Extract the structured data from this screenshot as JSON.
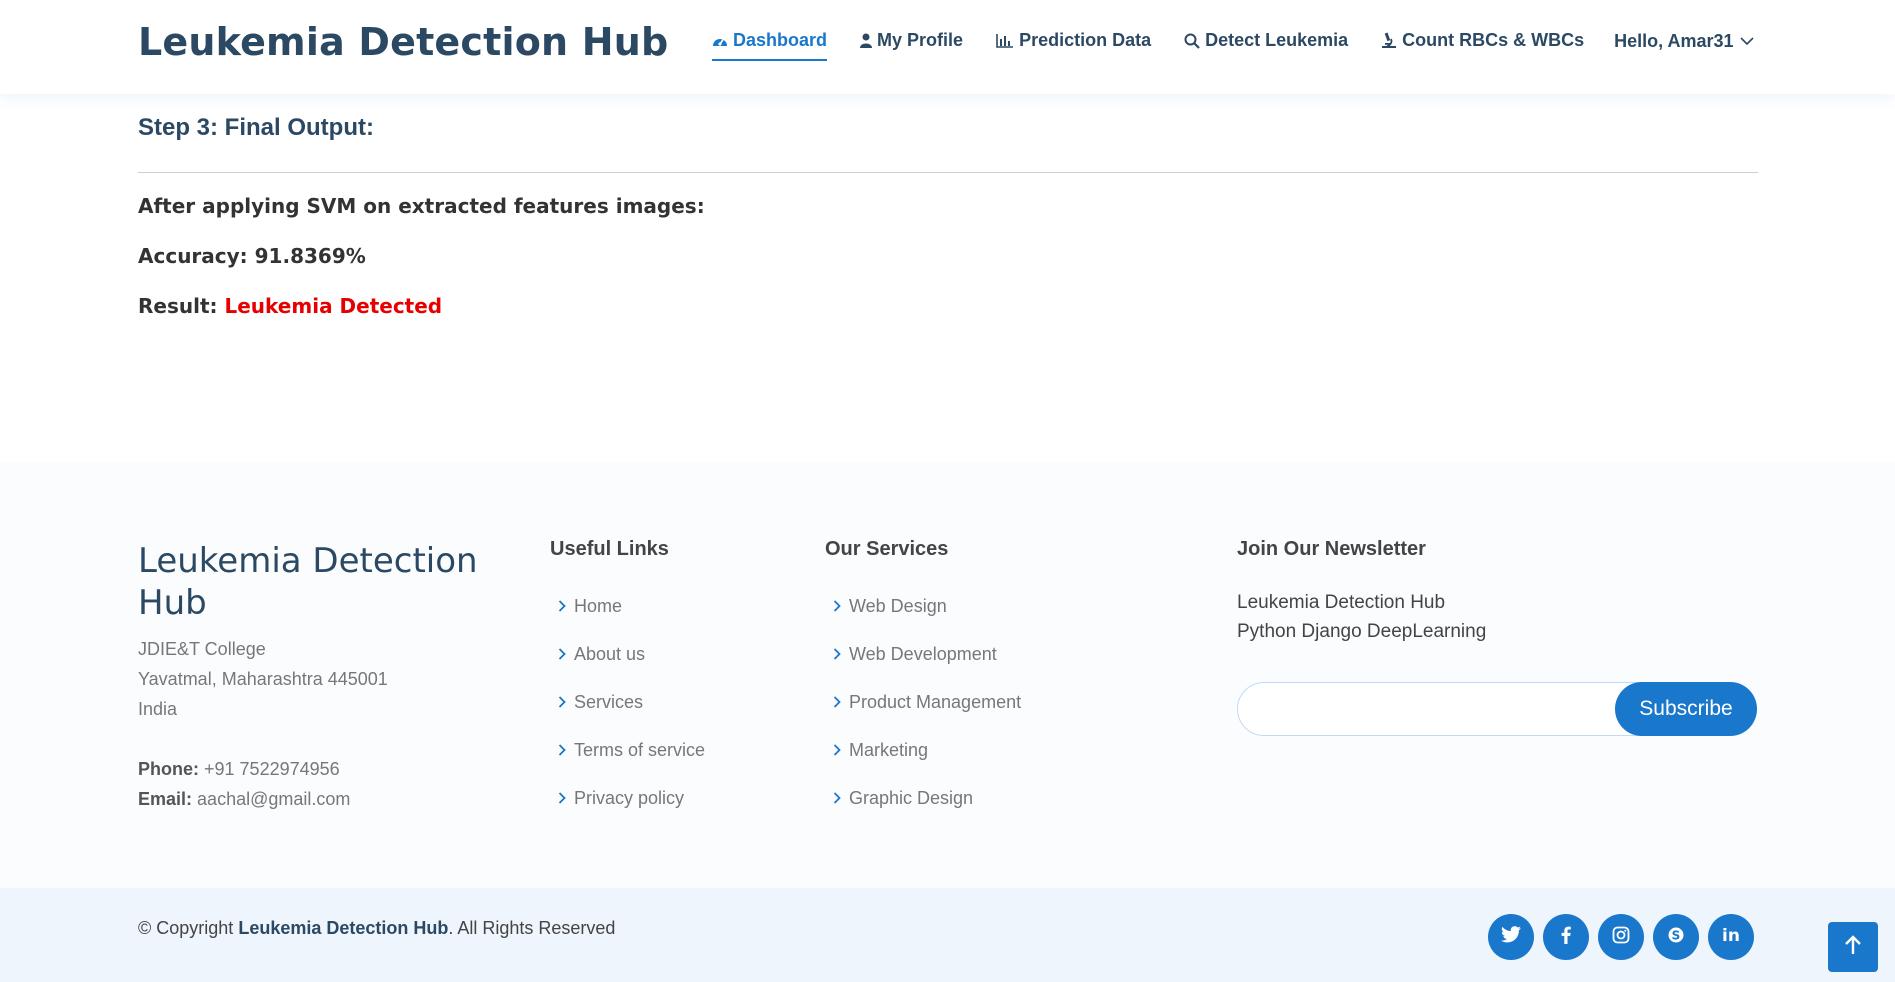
{
  "header": {
    "brand": "Leukemia Detection Hub",
    "nav": [
      {
        "label": "Dashboard",
        "icon": "dashboard-icon",
        "active": true
      },
      {
        "label": "My Profile",
        "icon": "user-icon"
      },
      {
        "label": "Prediction Data",
        "icon": "bar-chart-icon"
      },
      {
        "label": "Detect Leukemia",
        "icon": "search-icon"
      },
      {
        "label": "Count RBCs & WBCs",
        "icon": "microscope-icon"
      }
    ],
    "user_greeting": "Hello, Amar31"
  },
  "main": {
    "step_title": "Step 3: Final Output:",
    "line1": "After applying SVM on extracted features images:",
    "accuracy_label": "Accuracy: 91.8369%",
    "result_label": "Result:",
    "result_value": "Leukemia Detected",
    "result_color": "#e60000"
  },
  "footer": {
    "brand": "Leukemia Detection Hub",
    "address": [
      "JDIE&T College",
      "Yavatmal, Maharashtra 445001",
      "India"
    ],
    "phone_label": "Phone:",
    "phone": "+91 7522974956",
    "email_label": "Email:",
    "email": "aachal@gmail.com",
    "useful_links_title": "Useful Links",
    "useful_links": [
      "Home",
      "About us",
      "Services",
      "Terms of service",
      "Privacy policy"
    ],
    "services_title": "Our Services",
    "services": [
      "Web Design",
      "Web Development",
      "Product Management",
      "Marketing",
      "Graphic Design"
    ],
    "newsletter_title": "Join Our Newsletter",
    "newsletter_line1": "Leukemia Detection Hub",
    "newsletter_line2": "Python Django DeepLearning",
    "newsletter_input_value": "",
    "subscribe_label": "Subscribe",
    "copyright_prefix": "© Copyright",
    "copyright_brand": "Leukemia Detection Hub",
    "copyright_suffix": ". All Rights Reserved",
    "social": [
      "twitter-icon",
      "facebook-icon",
      "instagram-icon",
      "skype-icon",
      "linkedin-icon"
    ]
  },
  "colors": {
    "accent": "#1977cc",
    "heading": "#2c4964",
    "result_red": "#e60000"
  }
}
